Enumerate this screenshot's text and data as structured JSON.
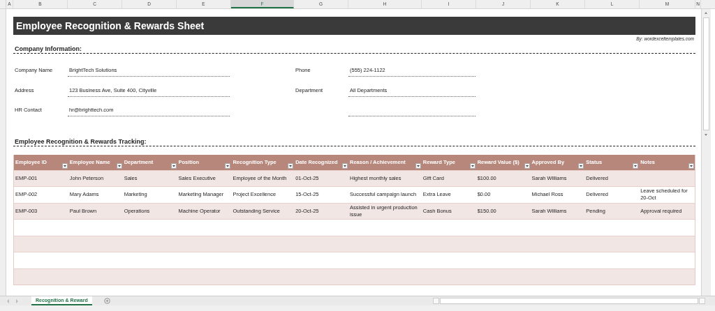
{
  "column_headers": [
    {
      "label": "A",
      "selected": false
    },
    {
      "label": "B",
      "selected": false
    },
    {
      "label": "C",
      "selected": false
    },
    {
      "label": "D",
      "selected": false
    },
    {
      "label": "E",
      "selected": false
    },
    {
      "label": "F",
      "selected": true
    },
    {
      "label": "G",
      "selected": false
    },
    {
      "label": "H",
      "selected": false
    },
    {
      "label": "I",
      "selected": false
    },
    {
      "label": "J",
      "selected": false
    },
    {
      "label": "K",
      "selected": false
    },
    {
      "label": "L",
      "selected": false
    },
    {
      "label": "M",
      "selected": false
    },
    {
      "label": "N",
      "selected": false
    }
  ],
  "title": "Employee Recognition & Rewards Sheet",
  "byline": "By: wordexceltemplates.com",
  "company_section": {
    "heading": "Company Information:",
    "rows": [
      {
        "left": {
          "label": "Company Name",
          "value": "BrightTech Solutions"
        },
        "right": {
          "label": "Phone",
          "value": "(555) 224-1122"
        }
      },
      {
        "left": {
          "label": "Address",
          "value": "123 Business Ave, Suite 400, Cityville"
        },
        "right": {
          "label": "Department",
          "value": "All Departments"
        }
      },
      {
        "left": {
          "label": "HR Contact",
          "value": "hr@brighttech.com"
        }
      }
    ]
  },
  "tracking_section": {
    "heading": "Employee Recognition & Rewards Tracking:",
    "columns": [
      "Employee ID",
      "Employee Name",
      "Department",
      "Position",
      "Recognition Type",
      "Date Recognized",
      "Reason / Achievement",
      "Reward Type",
      "Reward Value ($)",
      "Approved By",
      "Status",
      "Notes"
    ],
    "rows": [
      [
        "EMP-001",
        "John Peterson",
        "Sales",
        "Sales Executive",
        "Employee of the Month",
        "01-Oct-25",
        "Highest monthly sales",
        "Gift Card",
        "$100.00",
        "Sarah Williams",
        "Delivered",
        ""
      ],
      [
        "EMP-002",
        "Mary Adams",
        "Marketing",
        "Marketing Manager",
        "Project Excellence",
        "15-Oct-25",
        "Successful campaign launch",
        "Extra Leave",
        "$0.00",
        "Michael Ross",
        "Delivered",
        "Leave scheduled for 20-Oct"
      ],
      [
        "EMP-003",
        "Paul Brown",
        "Operations",
        "Machine Operator",
        "Outstanding Service",
        "20-Oct-25",
        "Assisted in urgent production issue",
        "Cash Bonus",
        "$150.00",
        "Sarah Williams",
        "Pending",
        "Approval required"
      ]
    ]
  },
  "sheet_tabs": [
    {
      "label": "Recognition & Reward",
      "selected": true
    }
  ]
}
